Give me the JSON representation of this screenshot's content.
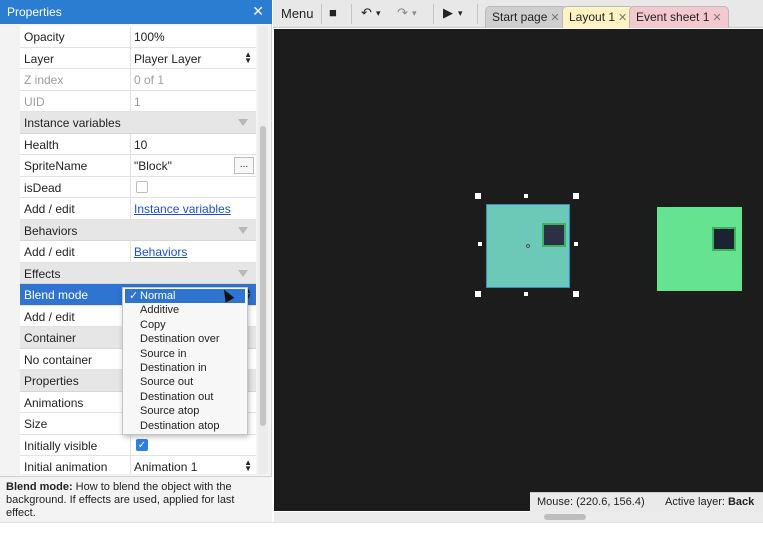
{
  "properties_panel": {
    "title": "Properties",
    "close_glyph": "✕",
    "rows": {
      "opacity": {
        "label": "Opacity",
        "value": "100%"
      },
      "layer": {
        "label": "Layer",
        "value": "Player Layer"
      },
      "zindex": {
        "label": "Z index",
        "value": "0 of 1"
      },
      "uid": {
        "label": "UID",
        "value": "1"
      },
      "instance_vars_section": {
        "label": "Instance variables"
      },
      "health": {
        "label": "Health",
        "value": "10"
      },
      "spritename": {
        "label": "SpriteName",
        "value": "\"Block\"",
        "button": "..."
      },
      "isdead": {
        "label": "isDead"
      },
      "add_edit_iv": {
        "label": "Add / edit",
        "link": "Instance variables"
      },
      "behaviors_section": {
        "label": "Behaviors"
      },
      "add_edit_beh": {
        "label": "Add / edit",
        "link": "Behaviors"
      },
      "effects_section": {
        "label": "Effects"
      },
      "blend_mode": {
        "label": "Blend mode"
      },
      "add_edit_eff": {
        "label": "Add / edit"
      },
      "container_section": {
        "label": "Container"
      },
      "no_container": {
        "label": "No container"
      },
      "properties_section": {
        "label": "Properties"
      },
      "animations": {
        "label": "Animations"
      },
      "size": {
        "label": "Size"
      },
      "initially_visible": {
        "label": "Initially visible",
        "check": "✓"
      },
      "initial_animation": {
        "label": "Initial animation",
        "value": "Animation 1"
      }
    },
    "spin_up": "▲",
    "spin_down": "▼",
    "help": {
      "bold": "Blend mode:",
      "text": " How to blend the object with the background. If effects are used, applied for last effect."
    }
  },
  "blend_dropdown": {
    "selected": "Normal",
    "check": "✓",
    "options": [
      "Additive",
      "Copy",
      "Destination over",
      "Source in",
      "Destination in",
      "Source out",
      "Destination out",
      "Source atop",
      "Destination atop"
    ]
  },
  "toolbar": {
    "menu_label": "Menu",
    "save_icon": "■",
    "undo_icon": "↶",
    "redo_icon": "↷",
    "dropdown_caret": "▾",
    "play_icon": "▶",
    "tabs": [
      {
        "label": "Start page",
        "close": "✕"
      },
      {
        "label": "Layout 1",
        "close": "✕"
      },
      {
        "label": "Event sheet 1",
        "close": "✕"
      }
    ]
  },
  "status": {
    "mouse": "Mouse: (220.6, 156.4)",
    "active_layer_label": "Active layer:",
    "active_layer_value": "Back"
  },
  "colors": {
    "accent": "#2a7dd1",
    "layout_bg": "#1c1c1c",
    "player_sprite": "#6cc9b8",
    "block_sprite": "#65e391",
    "tab_layout": "#fff3c4",
    "tab_event": "#f3c8cf",
    "tab_start": "#cfcfcf"
  }
}
